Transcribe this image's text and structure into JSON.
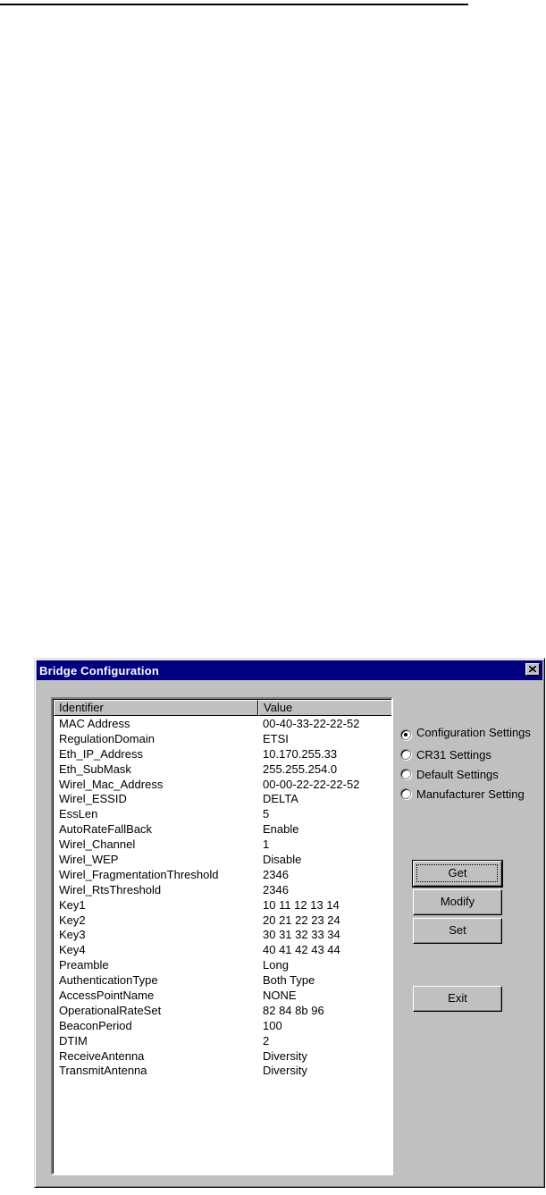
{
  "window": {
    "title": "Bridge Configuration"
  },
  "table": {
    "columns": [
      "Identifier",
      "Value"
    ],
    "rows": [
      {
        "id": "MAC Address",
        "value": "00-40-33-22-22-52"
      },
      {
        "id": "RegulationDomain",
        "value": "ETSI"
      },
      {
        "id": "Eth_IP_Address",
        "value": "10.170.255.33"
      },
      {
        "id": "Eth_SubMask",
        "value": "255.255.254.0"
      },
      {
        "id": "Wirel_Mac_Address",
        "value": "00-00-22-22-22-52"
      },
      {
        "id": "Wirel_ESSID",
        "value": "DELTA"
      },
      {
        "id": "EssLen",
        "value": "5"
      },
      {
        "id": "AutoRateFallBack",
        "value": "Enable"
      },
      {
        "id": "Wirel_Channel",
        "value": "1"
      },
      {
        "id": "Wirel_WEP",
        "value": "Disable"
      },
      {
        "id": "Wirel_FragmentationThreshold",
        "value": "2346"
      },
      {
        "id": "Wirel_RtsThreshold",
        "value": "2346"
      },
      {
        "id": "Key1",
        "value": "10 11 12 13 14"
      },
      {
        "id": "Key2",
        "value": "20 21 22 23 24"
      },
      {
        "id": "Key3",
        "value": "30 31 32 33 34"
      },
      {
        "id": "Key4",
        "value": "40 41 42 43 44"
      },
      {
        "id": "Preamble",
        "value": "Long"
      },
      {
        "id": "AuthenticationType",
        "value": "Both Type"
      },
      {
        "id": "AccessPointName",
        "value": "NONE"
      },
      {
        "id": "OperationalRateSet",
        "value": "82 84 8b 96"
      },
      {
        "id": "BeaconPeriod",
        "value": "100"
      },
      {
        "id": "DTIM",
        "value": "2"
      },
      {
        "id": "ReceiveAntenna",
        "value": "Diversity"
      },
      {
        "id": "TransmitAntenna",
        "value": "Diversity"
      }
    ]
  },
  "radios": [
    {
      "label": "Configuration Settings",
      "checked": true
    },
    {
      "label": "CR31 Settings",
      "checked": false
    },
    {
      "label": "Default Settings",
      "checked": false
    },
    {
      "label": "Manufacturer Setting",
      "checked": false
    }
  ],
  "buttons": {
    "get": "Get",
    "modify": "Modify",
    "set": "Set",
    "exit": "Exit"
  }
}
